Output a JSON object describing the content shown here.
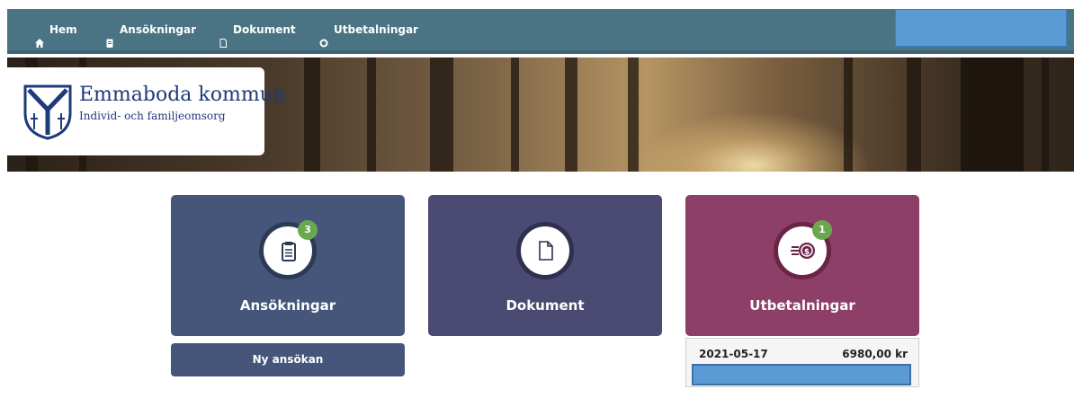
{
  "nav": {
    "items": [
      {
        "label": "Hem",
        "icon": "home-icon"
      },
      {
        "label": "Ansökningar",
        "icon": "clipboard-icon"
      },
      {
        "label": "Dokument",
        "icon": "document-icon"
      },
      {
        "label": "Utbetalningar",
        "icon": "money-icon"
      }
    ]
  },
  "logo": {
    "title": "Emmaboda kommun",
    "subtitle": "Individ- och familjeomsorg"
  },
  "cards": [
    {
      "label": "Ansökningar",
      "icon": "clipboard-icon",
      "badge": "3",
      "color": "#46567a"
    },
    {
      "label": "Dokument",
      "icon": "document-icon",
      "badge": "",
      "color": "#4a4a72"
    },
    {
      "label": "Utbetalningar",
      "icon": "money-icon",
      "badge": "1",
      "color": "#8e3f68"
    }
  ],
  "new_application_button": "Ny ansökan",
  "payment": {
    "date": "2021-05-17",
    "amount": "6980,00 kr"
  },
  "colors": {
    "nav_bg": "#4a7484",
    "badge_green": "#6aa84f",
    "redaction_blue": "#5b9bd5"
  }
}
